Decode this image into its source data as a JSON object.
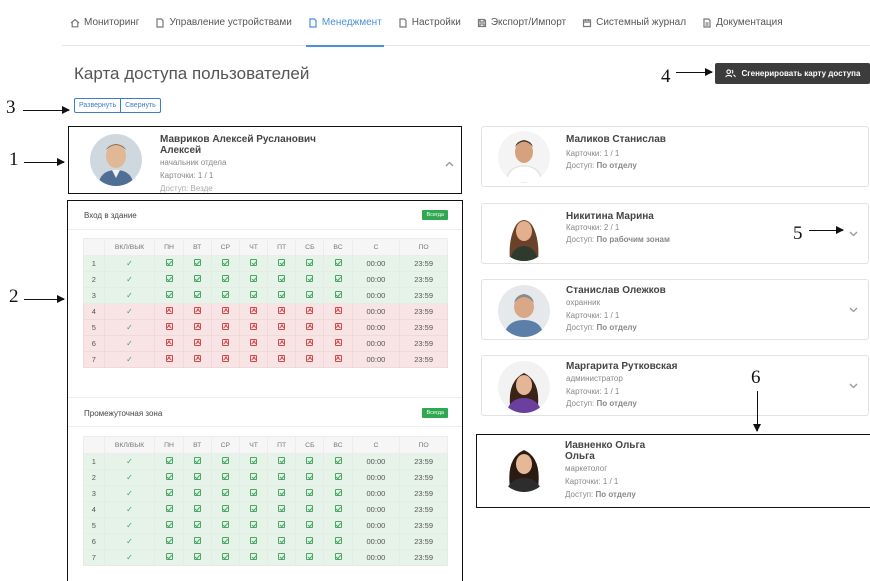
{
  "nav": {
    "items": [
      {
        "label": "Мониторинг",
        "icon": "home-icon"
      },
      {
        "label": "Управление устройствами",
        "icon": "document-icon"
      },
      {
        "label": "Менеджмент",
        "icon": "document-icon",
        "active": true
      },
      {
        "label": "Настройки",
        "icon": "document-icon"
      },
      {
        "label": "Экспорт/Импорт",
        "icon": "save-icon"
      },
      {
        "label": "Системный журнал",
        "icon": "calendar-icon"
      },
      {
        "label": "Документация",
        "icon": "document-icon"
      }
    ]
  },
  "page": {
    "title": "Карта доступа пользователей",
    "generate_button": "Сгенерировать карту доступа",
    "expand_label": "Развернуть",
    "collapse_label": "Свернуть"
  },
  "callouts": [
    "1",
    "2",
    "3",
    "4",
    "5",
    "6"
  ],
  "selected_user": {
    "name_line1": "Мавриков Алексей Русланович",
    "name_line2": "Алексей",
    "role": "начальник отдела",
    "cards": "Карточки: 1 / 1",
    "access": "Доступ: Везде"
  },
  "users": [
    {
      "name_line1": "Маликов Станислав",
      "name_line2": "",
      "role": "",
      "cards": "Карточки: 1 / 1",
      "access_prefix": "Доступ: ",
      "access_value": "По отделу"
    },
    {
      "name_line1": "Никитина Марина",
      "name_line2": "",
      "role": "",
      "cards": "Карточки: 2 / 1",
      "access_prefix": "Доступ: ",
      "access_value": "По рабочим зонам"
    },
    {
      "name_line1": "Станислав Олежков",
      "name_line2": "",
      "role": "охранник",
      "cards": "Карточки: 1 / 1",
      "access_prefix": "Доступ: ",
      "access_value": "По отделу"
    },
    {
      "name_line1": "Маргарита Рутковская",
      "name_line2": "",
      "role": "администратор",
      "cards": "Карточки: 1 / 1",
      "access_prefix": "Доступ: ",
      "access_value": "По отделу"
    },
    {
      "name_line1": "Иавненко Ольга",
      "name_line2": "Ольга",
      "role": "маркетолог",
      "cards": "Карточки: 1 / 1",
      "access_prefix": "Доступ: ",
      "access_value": "По отделу"
    }
  ],
  "zones": [
    {
      "title": "Вход в здание",
      "badge": "Всегда",
      "columns": [
        "",
        "ВКЛ/ВЫК",
        "ПН",
        "ВТ",
        "СР",
        "ЧТ",
        "ПТ",
        "СБ",
        "ВС",
        "С",
        "ПО"
      ],
      "rows": [
        {
          "n": "1",
          "allowed": true,
          "from": "00:00",
          "to": "23:59"
        },
        {
          "n": "2",
          "allowed": true,
          "from": "00:00",
          "to": "23:59"
        },
        {
          "n": "3",
          "allowed": true,
          "from": "00:00",
          "to": "23:59"
        },
        {
          "n": "4",
          "allowed": false,
          "from": "00:00",
          "to": "23:59"
        },
        {
          "n": "5",
          "allowed": false,
          "from": "00:00",
          "to": "23:59"
        },
        {
          "n": "6",
          "allowed": false,
          "from": "00:00",
          "to": "23:59"
        },
        {
          "n": "7",
          "allowed": false,
          "from": "00:00",
          "to": "23:59"
        }
      ]
    },
    {
      "title": "Промежуточная зона",
      "badge": "Всегда",
      "columns": [
        "",
        "ВКЛ/ВЫК",
        "ПН",
        "ВТ",
        "СР",
        "ЧТ",
        "ПТ",
        "СБ",
        "ВС",
        "С",
        "ПО"
      ],
      "rows": [
        {
          "n": "1",
          "allowed": true,
          "from": "00:00",
          "to": "23:59"
        },
        {
          "n": "2",
          "allowed": true,
          "from": "00:00",
          "to": "23:59"
        },
        {
          "n": "3",
          "allowed": true,
          "from": "00:00",
          "to": "23:59"
        },
        {
          "n": "4",
          "allowed": true,
          "from": "00:00",
          "to": "23:59"
        },
        {
          "n": "5",
          "allowed": true,
          "from": "00:00",
          "to": "23:59"
        },
        {
          "n": "6",
          "allowed": true,
          "from": "00:00",
          "to": "23:59"
        },
        {
          "n": "7",
          "allowed": true,
          "from": "00:00",
          "to": "23:59"
        }
      ]
    }
  ],
  "colors": {
    "accent": "#4a90d9",
    "ok": "#e6f3e8",
    "deny": "#f8e4e4",
    "badge": "#2fa84f"
  }
}
